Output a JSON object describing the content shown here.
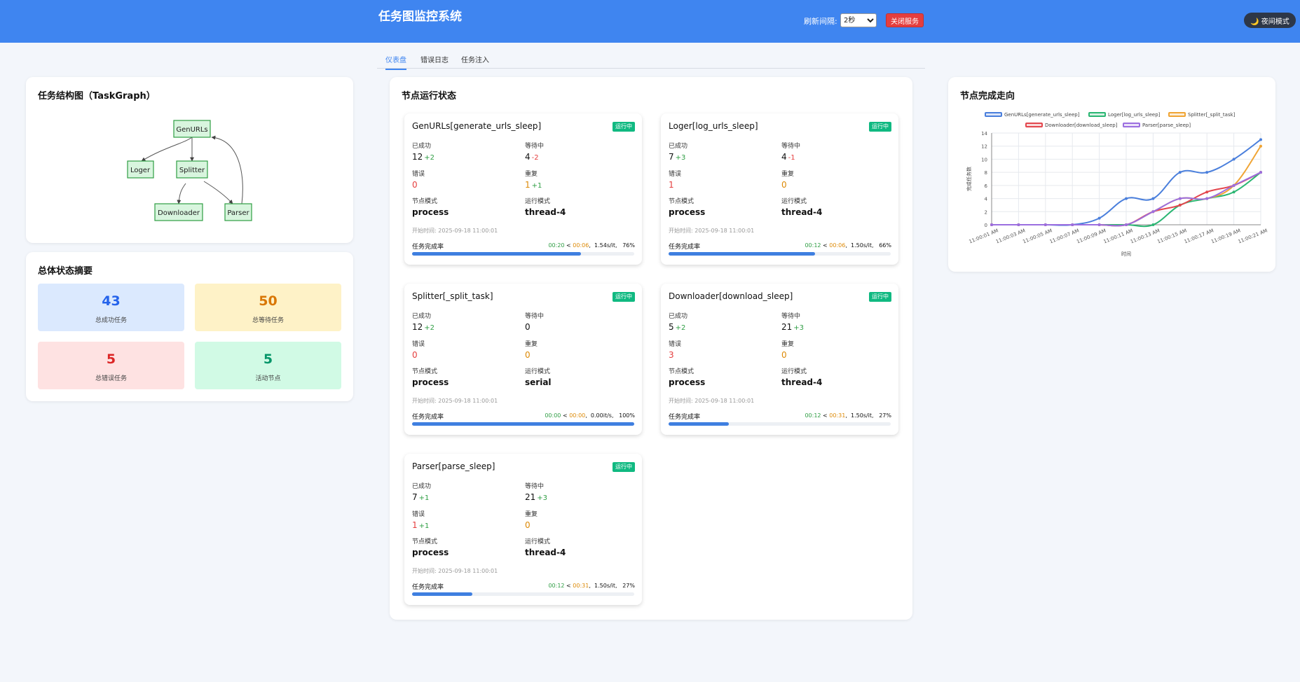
{
  "app": {
    "title": "任务图监控系统"
  },
  "header": {
    "refresh_label": "刷新间隔:",
    "refresh_value": "2秒",
    "stop_button": "关闭服务",
    "night_button": "🌙 夜间模式"
  },
  "tabs": [
    {
      "label": "仪表盘",
      "active": true
    },
    {
      "label": "错误日志",
      "active": false
    },
    {
      "label": "任务注入",
      "active": false
    }
  ],
  "graph": {
    "title": "任务结构图（TaskGraph）",
    "nodes": [
      "GenURLs",
      "Loger",
      "Splitter",
      "Downloader",
      "Parser"
    ]
  },
  "summary": {
    "title": "总体状态摘要",
    "stats": [
      {
        "value": "43",
        "label": "总成功任务",
        "bg": "#dbe9fe",
        "color": "#2563eb"
      },
      {
        "value": "50",
        "label": "总等待任务",
        "bg": "#fef2c7",
        "color": "#d97706"
      },
      {
        "value": "5",
        "label": "总错误任务",
        "bg": "#fee2e2",
        "color": "#dc2626"
      },
      {
        "value": "5",
        "label": "活动节点",
        "bg": "#d1fae5",
        "color": "#059669"
      }
    ]
  },
  "nodes_panel": {
    "title": "节点运行状态",
    "labels": {
      "success": "已成功",
      "pending": "等待中",
      "error": "错误",
      "retry": "重复",
      "node_mode": "节点模式",
      "run_mode": "运行模式",
      "start_prefix": "开始时间: ",
      "progress": "任务完成率"
    },
    "cards": [
      {
        "name": "GenURLs[generate_urls_sleep]",
        "status": "运行中",
        "success": "12",
        "success_delta": "+2",
        "success_delta_color": "green",
        "pending": "4",
        "pending_delta": "-2",
        "pending_delta_color": "red",
        "error": "0",
        "error_delta": "",
        "retry": "1",
        "retry_delta": "+1",
        "node_mode": "process",
        "run_mode": "thread-4",
        "start_time": "2025-09-18 11:00:01",
        "elapsed": "00:20",
        "remaining": "00:06",
        "rate": "1.54s/it,",
        "percent": "76%",
        "progress": 0.76
      },
      {
        "name": "Loger[log_urls_sleep]",
        "status": "运行中",
        "success": "7",
        "success_delta": "+3",
        "success_delta_color": "green",
        "pending": "4",
        "pending_delta": "-1",
        "pending_delta_color": "red",
        "error": "1",
        "error_delta": "",
        "retry": "0",
        "retry_delta": "",
        "node_mode": "process",
        "run_mode": "thread-4",
        "start_time": "2025-09-18 11:00:01",
        "elapsed": "00:12",
        "remaining": "00:06",
        "rate": "1.50s/it,",
        "percent": "66%",
        "progress": 0.66
      },
      {
        "name": "Splitter[_split_task]",
        "status": "运行中",
        "success": "12",
        "success_delta": "+2",
        "success_delta_color": "green",
        "pending": "0",
        "pending_delta": "",
        "pending_delta_color": "green",
        "error": "0",
        "error_delta": "",
        "retry": "0",
        "retry_delta": "",
        "node_mode": "process",
        "run_mode": "serial",
        "start_time": "2025-09-18 11:00:01",
        "elapsed": "00:00",
        "remaining": "00:00",
        "rate": "0.00it/s,",
        "percent": "100%",
        "progress": 1.0
      },
      {
        "name": "Downloader[download_sleep]",
        "status": "运行中",
        "success": "5",
        "success_delta": "+2",
        "success_delta_color": "green",
        "pending": "21",
        "pending_delta": "+3",
        "pending_delta_color": "green",
        "error": "3",
        "error_delta": "",
        "retry": "0",
        "retry_delta": "",
        "node_mode": "process",
        "run_mode": "thread-4",
        "start_time": "2025-09-18 11:00:01",
        "elapsed": "00:12",
        "remaining": "00:31",
        "rate": "1.50s/it,",
        "percent": "27%",
        "progress": 0.27
      },
      {
        "name": "Parser[parse_sleep]",
        "status": "运行中",
        "success": "7",
        "success_delta": "+1",
        "success_delta_color": "green",
        "pending": "21",
        "pending_delta": "+3",
        "pending_delta_color": "green",
        "error": "1",
        "error_delta": "+1",
        "retry": "0",
        "retry_delta": "",
        "node_mode": "process",
        "run_mode": "thread-4",
        "start_time": "2025-09-18 11:00:01",
        "elapsed": "00:12",
        "remaining": "00:31",
        "rate": "1.50s/it,",
        "percent": "27%",
        "progress": 0.27
      }
    ]
  },
  "trend": {
    "title": "节点完成走向",
    "chart_data": {
      "type": "line",
      "ylabel": "完成任务数",
      "xlabel": "时间",
      "ylim": [
        0,
        14
      ],
      "yticks": [
        0,
        2,
        4,
        6,
        8,
        10,
        12,
        14
      ],
      "grid": true,
      "legend": "top",
      "categories": [
        "11:00:01 AM",
        "11:00:03 AM",
        "11:00:05 AM",
        "11:00:07 AM",
        "11:00:09 AM",
        "11:00:11 AM",
        "11:00:13 AM",
        "11:00:15 AM",
        "11:00:17 AM",
        "11:00:19 AM",
        "11:00:21 AM"
      ],
      "x": [
        1,
        3,
        5,
        7,
        8,
        9,
        10,
        11,
        12,
        13,
        14,
        15,
        16,
        17,
        18,
        19,
        20,
        21,
        22
      ],
      "series": [
        {
          "name": "GenURLs[generate_urls_sleep]",
          "color": "#4a7fdc",
          "values": [
            0,
            0,
            0,
            0,
            1,
            4,
            4,
            8,
            8,
            10,
            13
          ]
        },
        {
          "name": "Loger[log_urls_sleep]",
          "color": "#2bb673",
          "values": [
            0,
            0,
            0,
            0,
            0,
            0,
            0,
            3,
            4,
            5,
            8
          ]
        },
        {
          "name": "Splitter[_split_task]",
          "color": "#f0a535",
          "values": [
            0,
            0,
            0,
            0,
            0,
            0,
            2,
            4,
            4,
            6,
            12
          ]
        },
        {
          "name": "Downloader[download_sleep]",
          "color": "#e3464d",
          "values": [
            0,
            0,
            0,
            0,
            0,
            0,
            2,
            3,
            5,
            6,
            8
          ]
        },
        {
          "name": "Parser[parse_sleep]",
          "color": "#9b6ee0",
          "values": [
            0,
            0,
            0,
            0,
            0,
            0,
            2,
            4,
            4,
            6,
            8
          ]
        }
      ]
    }
  }
}
